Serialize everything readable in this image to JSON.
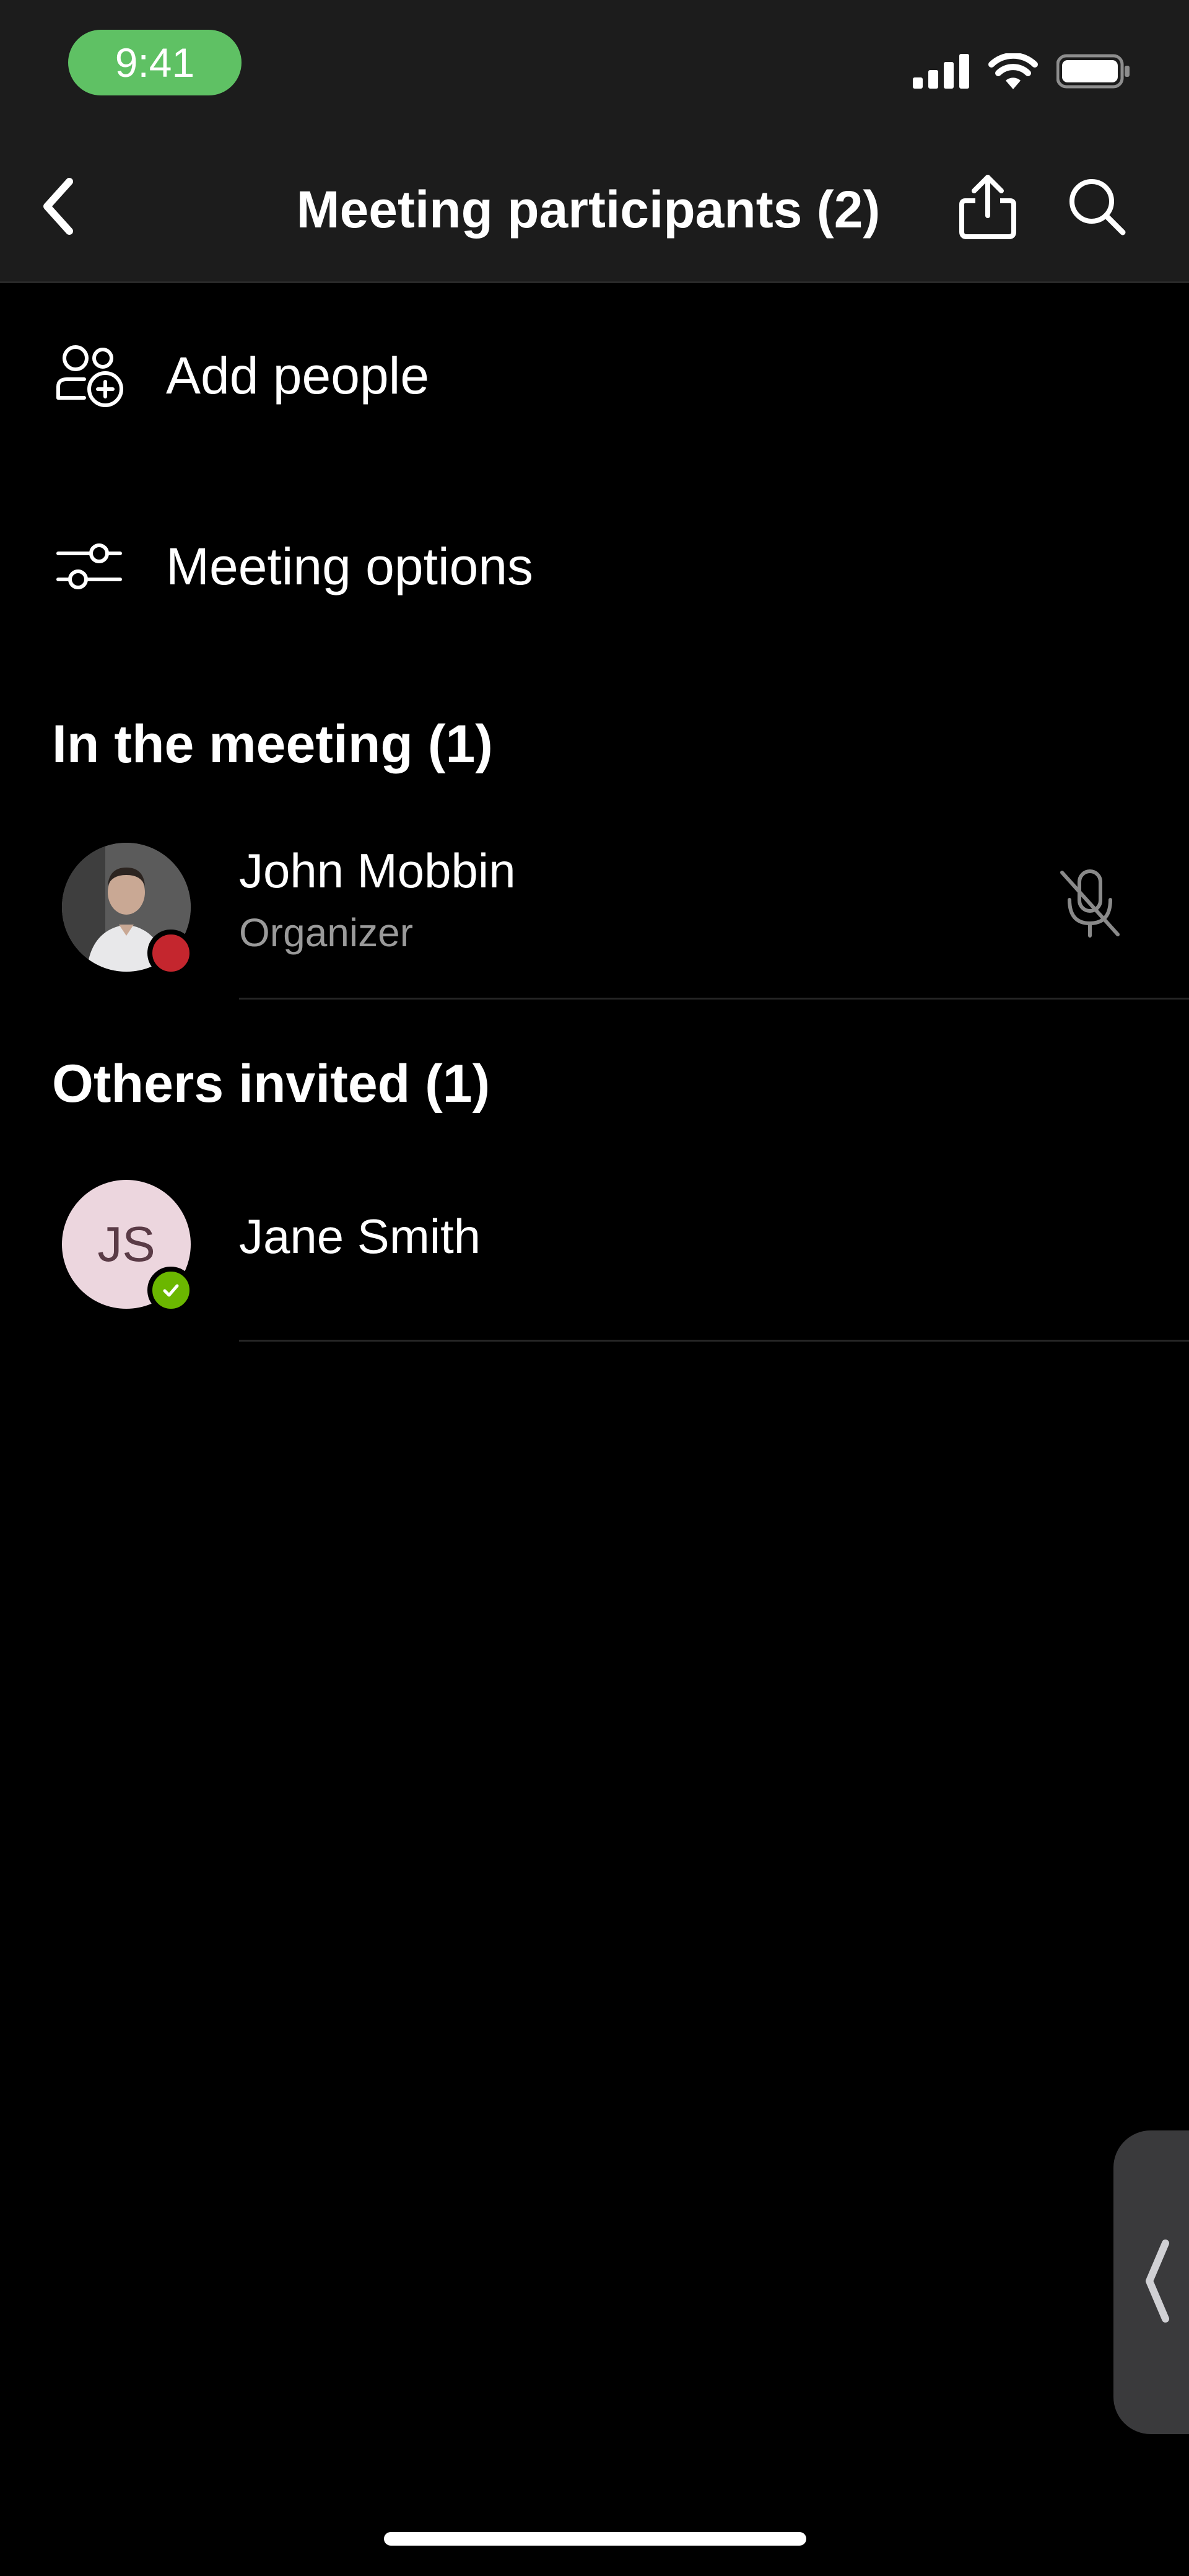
{
  "status_bar": {
    "time": "9:41"
  },
  "nav": {
    "title": "Meeting participants (2)",
    "back_icon": "chevron-left-icon",
    "share_icon": "share-icon",
    "search_icon": "search-icon"
  },
  "actions": [
    {
      "label": "Add people",
      "icon": "add-people-icon"
    },
    {
      "label": "Meeting options",
      "icon": "sliders-icon"
    }
  ],
  "in_meeting": {
    "header": "In the meeting (1)",
    "people": [
      {
        "name": "John Mobbin",
        "role": "Organizer",
        "presence": "busy",
        "presence_color": "#c4262e",
        "mic": "mic-off-icon"
      }
    ]
  },
  "others_invited": {
    "header": "Others invited (1)",
    "people": [
      {
        "name": "Jane Smith",
        "initials": "JS",
        "presence": "available",
        "presence_color": "#6bb700"
      }
    ]
  },
  "colors": {
    "background": "#000000",
    "bar_background": "#1c1c1c",
    "time_pill": "#5fc164",
    "secondary_text": "#9a9a9a"
  }
}
